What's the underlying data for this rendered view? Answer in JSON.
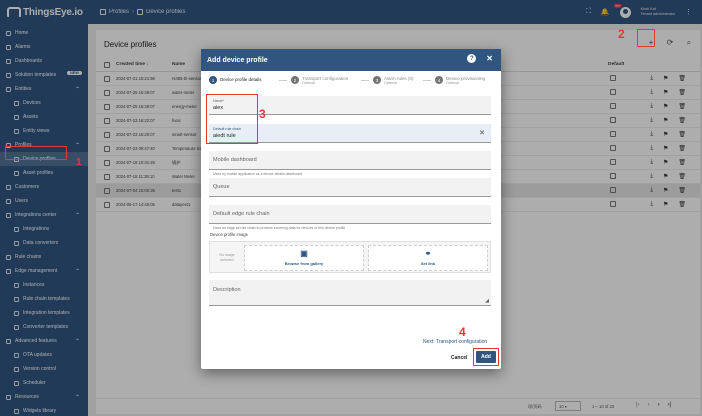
{
  "app": {
    "logo": "ThingsEye.io"
  },
  "header": {
    "breadcrumb": [
      "Profiles",
      "Device profiles"
    ],
    "notif_count": "99+",
    "user_name": "Kristi Kat",
    "user_role": "Tenant administrator"
  },
  "sidebar": {
    "items": [
      {
        "label": "Home",
        "sub": false
      },
      {
        "label": "Alarms",
        "sub": false
      },
      {
        "label": "Dashboards",
        "sub": false
      },
      {
        "label": "Solution templates",
        "sub": false,
        "badge": "NEW"
      },
      {
        "label": "Entities",
        "sub": false,
        "chev": true
      },
      {
        "label": "Devices",
        "sub": true
      },
      {
        "label": "Assets",
        "sub": true
      },
      {
        "label": "Entity views",
        "sub": true
      },
      {
        "label": "Profiles",
        "sub": false,
        "chev": true
      },
      {
        "label": "Device profiles",
        "sub": true,
        "active": true
      },
      {
        "label": "Asset profiles",
        "sub": true
      },
      {
        "label": "Customers",
        "sub": false
      },
      {
        "label": "Users",
        "sub": false
      },
      {
        "label": "Integrations center",
        "sub": false,
        "chev": true
      },
      {
        "label": "Integrations",
        "sub": true
      },
      {
        "label": "Data converters",
        "sub": true
      },
      {
        "label": "Rule chains",
        "sub": false
      },
      {
        "label": "Edge management",
        "sub": false,
        "chev": true
      },
      {
        "label": "Instances",
        "sub": true
      },
      {
        "label": "Rule chain templates",
        "sub": true
      },
      {
        "label": "Integration templates",
        "sub": true
      },
      {
        "label": "Converter templates",
        "sub": true
      },
      {
        "label": "Advanced features",
        "sub": false,
        "chev": true
      },
      {
        "label": "OTA updates",
        "sub": true
      },
      {
        "label": "Version control",
        "sub": true
      },
      {
        "label": "Scheduler",
        "sub": true
      },
      {
        "label": "Resources",
        "sub": false,
        "chev": true
      },
      {
        "label": "Widgets library",
        "sub": true
      }
    ]
  },
  "main": {
    "title": "Device profiles",
    "columns": {
      "created": "Created time ↓",
      "name": "Name",
      "default": "Default"
    },
    "rows": [
      {
        "created": "2024-07-31 15:21:56",
        "name": "rs485-th-sensor"
      },
      {
        "created": "2024-07-25 16:39:07",
        "name": "water-meter"
      },
      {
        "created": "2024-07-25 16:39:07",
        "name": "energy-meter"
      },
      {
        "created": "2024-07-23 16:22:07",
        "name": "hvac"
      },
      {
        "created": "2024-07-23 16:20:07",
        "name": "smart-sensor"
      },
      {
        "created": "2024-07-23 09:47:40",
        "name": "Temperature Sensor"
      },
      {
        "created": "2024-07-18 10:31:26",
        "name": "锅炉"
      },
      {
        "created": "2024-07-18 11:38:10",
        "name": "Water Meter"
      },
      {
        "created": "2024-07-04 15:00:35",
        "name": "test1"
      },
      {
        "created": "2024-06-17 14:45:05",
        "name": "datayeet1"
      }
    ],
    "items_per_page_label": "项/页码",
    "items_per_page": "10",
    "range": "1 – 10 of 23"
  },
  "dialog": {
    "title": "Add device profile",
    "steps": [
      {
        "num": "1",
        "label": "Device profile details",
        "optional": ""
      },
      {
        "num": "2",
        "label": "Transport configuration",
        "optional": "Optional"
      },
      {
        "num": "3",
        "label": "Alarm rules (0)",
        "optional": "Optional"
      },
      {
        "num": "4",
        "label": "Device provisioning",
        "optional": "Optional"
      }
    ],
    "name_label": "Name*",
    "name_value": "aiex",
    "rule_chain_label": "Default rule chain",
    "rule_chain_value": "aiedt rule",
    "mobile_dashboard_placeholder": "Mobile dashboard",
    "mobile_dashboard_hint": "Used by mobile application as a device details dashboard",
    "queue_placeholder": "Queue",
    "edge_rule_chain_placeholder": "Default edge rule chain",
    "edge_rule_chain_hint": "Used on edge as rule chain to process incoming data for devices of this device profile",
    "image_label": "Device profile image",
    "no_image": "No image selected",
    "browse_label": "Browse from gallery",
    "set_link_label": "Set link",
    "description_placeholder": "Description",
    "next_label": "Next: Transport configuration",
    "cancel_label": "Cancel",
    "add_label": "Add"
  },
  "annotations": [
    "1",
    "2",
    "3",
    "4"
  ],
  "colors": {
    "brand": "#305680",
    "annotation": "#e53935"
  }
}
